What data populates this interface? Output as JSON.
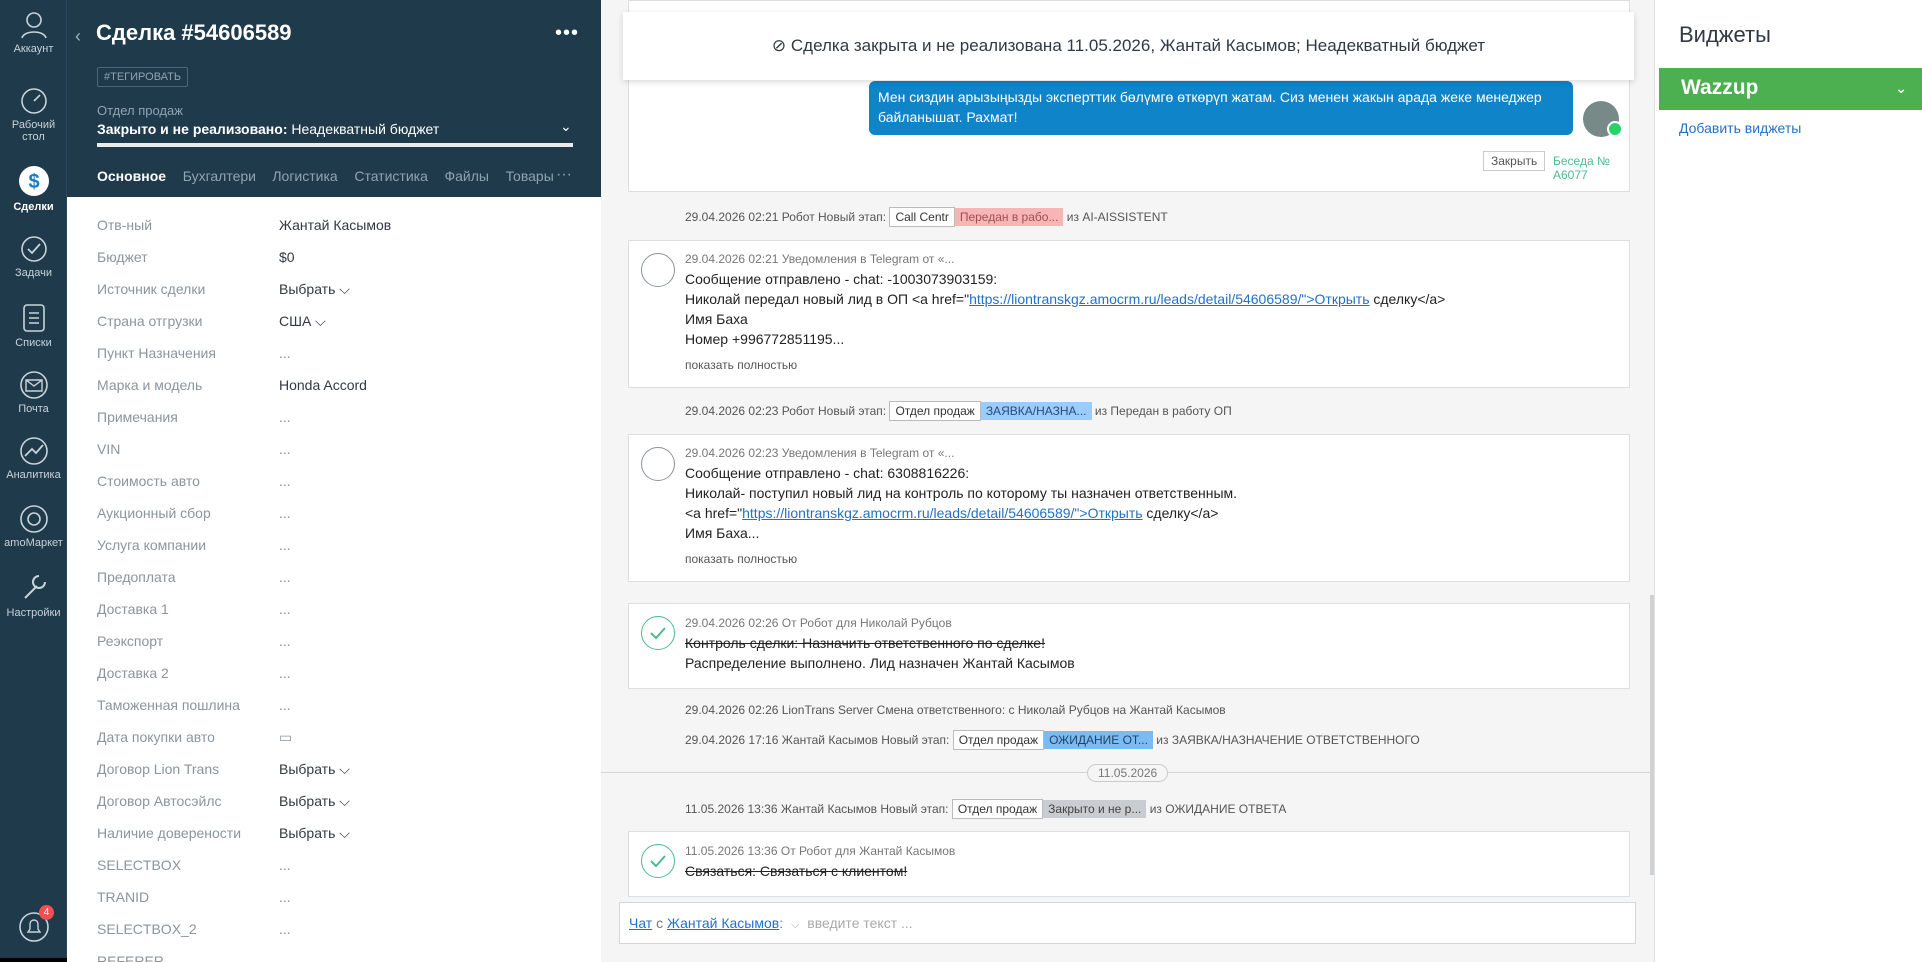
{
  "nav": [
    {
      "label": "Аккаунт",
      "icon": "account-icon"
    },
    {
      "label": "Рабочий стол",
      "icon": "dashboard-icon"
    },
    {
      "label": "Сделки",
      "icon": "deals-icon"
    },
    {
      "label": "Задачи",
      "icon": "tasks-icon"
    },
    {
      "label": "Списки",
      "icon": "lists-icon"
    },
    {
      "label": "Почта",
      "icon": "mail-icon"
    },
    {
      "label": "Аналитика",
      "icon": "analytics-icon"
    },
    {
      "label": "amoМаркет",
      "icon": "market-icon"
    },
    {
      "label": "Настройки",
      "icon": "settings-icon"
    }
  ],
  "notifications_count": "4",
  "card": {
    "title": "Сделка #54606589",
    "tag_button": "#ТЕГИРОВАТЬ",
    "pipeline_label": "Отдел продаж",
    "pipeline_status": "Закрыто и не реализовано:",
    "pipeline_reason": " Неадекватный бюджет",
    "tabs": [
      "Основное",
      "Бухгалтерия",
      "Логистика",
      "Статистика",
      "Файлы",
      "Товары"
    ],
    "fields": [
      {
        "label": "Отв-ный",
        "value": "Жантай Касымов"
      },
      {
        "label": "Бюджет",
        "value": "$0"
      },
      {
        "label": "Источник сделки",
        "value": "Выбрать ⌵"
      },
      {
        "label": "Страна отгрузки",
        "value": "США ⌵"
      },
      {
        "label": "Пункт Назначения",
        "value": "..."
      },
      {
        "label": "Марка и модель",
        "value": "Honda Accord"
      },
      {
        "label": "Примечания",
        "value": "..."
      },
      {
        "label": "VIN",
        "value": "..."
      },
      {
        "label": "Стоимость авто",
        "value": "..."
      },
      {
        "label": "Аукционный сбор",
        "value": "..."
      },
      {
        "label": "Услуга компании",
        "value": "..."
      },
      {
        "label": "Предоплата",
        "value": "..."
      },
      {
        "label": "Доставка 1",
        "value": "..."
      },
      {
        "label": "Реэкспорт",
        "value": "..."
      },
      {
        "label": "Доставка 2",
        "value": "..."
      },
      {
        "label": "Таможенная пошлина",
        "value": "..."
      },
      {
        "label": "Дата покупки авто",
        "value": "▭"
      },
      {
        "label": "Договор Lion Trans",
        "value": "Выбрать ⌵"
      },
      {
        "label": "Договор Автосэйлс",
        "value": "Выбрать ⌵"
      },
      {
        "label": "Наличие довереноcти",
        "value": "Выбрать ⌵"
      },
      {
        "label": "SELECTBOX",
        "value": "..."
      },
      {
        "label": "TRANID",
        "value": "..."
      },
      {
        "label": "SELECTBOX_2",
        "value": "..."
      },
      {
        "label": "REFERER",
        "value": ""
      }
    ]
  },
  "feed": {
    "notice": "⊘  Сделка закрыта и не реализована 11.05.2026, Жантай Касымов; Неадекватный бюджет",
    "chat_message": "Мен сиздин арызыңызды эксперттик бөлүмгө өткөрүп жатам. Сиз менен жакын арада жеке менеджер байланышат. Рахмат!",
    "close_button": "Закрыть",
    "conversation_link": "Беседа № A6077",
    "events": [
      {
        "prefix": "29.04.2026 02:21 Робот Новый этап:",
        "pipeline": "Call Centr",
        "stage": "Передан в рабо...",
        "suffix": "из AI-AISSISTENT"
      },
      {
        "prefix": "29.04.2026 02:23 Робот Новый этап:",
        "pipeline": "Отдел продаж",
        "stage": "ЗАЯВКА/НАЗНА...",
        "suffix": "из Передан в работу ОП"
      },
      {
        "text": "29.04.2026 02:26 LionTrans Server Смена ответственного: с Николай Рубцов на Жантай Касымов"
      },
      {
        "prefix": "29.04.2026 17:16 Жантай Касымов Новый этап:",
        "pipeline": "Отдел продаж",
        "stage": "ОЖИДАНИЕ ОТ...",
        "suffix": "из ЗАЯВКА/НАЗНАЧЕНИЕ ОТВЕТСТВЕННОГО"
      },
      {
        "prefix": "11.05.2026 13:36 Жантай Касымов Новый этап:",
        "pipeline": "Отдел продаж",
        "stage": "Закрыто и не р...",
        "suffix": "из ОЖИДАНИЕ ОТВЕТА"
      }
    ],
    "note1": {
      "meta": "29.04.2026 02:21 Уведомления в Telegram от «...",
      "line1": "Сообщение отправлено - chat: -1003073903159:",
      "line2_pre": "Николай передал новый лид в ОП <a href=\"",
      "line2_link": "https://liontranskgz.amocrm.ru/leads/detail/54606589/\">Открыть",
      "line2_post": " сделку</a>",
      "line3": "Имя Баха",
      "line4": "Номер +996772851195...",
      "more": "показать полностью"
    },
    "note2": {
      "meta": "29.04.2026 02:23 Уведомления в Telegram от «...",
      "line1": "Сообщение отправлено - chat: 6308816226:",
      "line2": "Николай- поступил новый лид на контроль по которому ты назначен ответственным.",
      "line3_pre": "<a href=\"",
      "line3_link": "https://liontranskgz.amocrm.ru/leads/detail/54606589/\">Открыть",
      "line3_post": " сделку</a>",
      "line4": "Имя Баха...",
      "more": "показать полностью"
    },
    "task1": {
      "meta": "29.04.2026 02:26  От Робот для Николай Рубцов",
      "title": "Контроль сделки: Назначить ответственного по сделке!",
      "result": "Распределение выполнено. Лид назначен Жантай Касымов"
    },
    "date_separator": "11.05.2026",
    "task2": {
      "meta": "11.05.2026 13:36  От Робот для Жантай Касымов",
      "title": "Связаться: Связаться с клиентом!"
    },
    "chat_input": {
      "chat_label": "Чат",
      "with": " с ",
      "recipient": "Жантай Касымов",
      "colon": ":",
      "placeholder": "введите текст ..."
    }
  },
  "widgets": {
    "title": "Виджеты",
    "wazzup": "Wazzup",
    "add_link": "Добавить виджеты"
  },
  "colors": {
    "nav_bg": "#1f3a4b",
    "bubble": "#0f84c8",
    "wazzup": "#4caf50",
    "link": "#2371c7"
  }
}
